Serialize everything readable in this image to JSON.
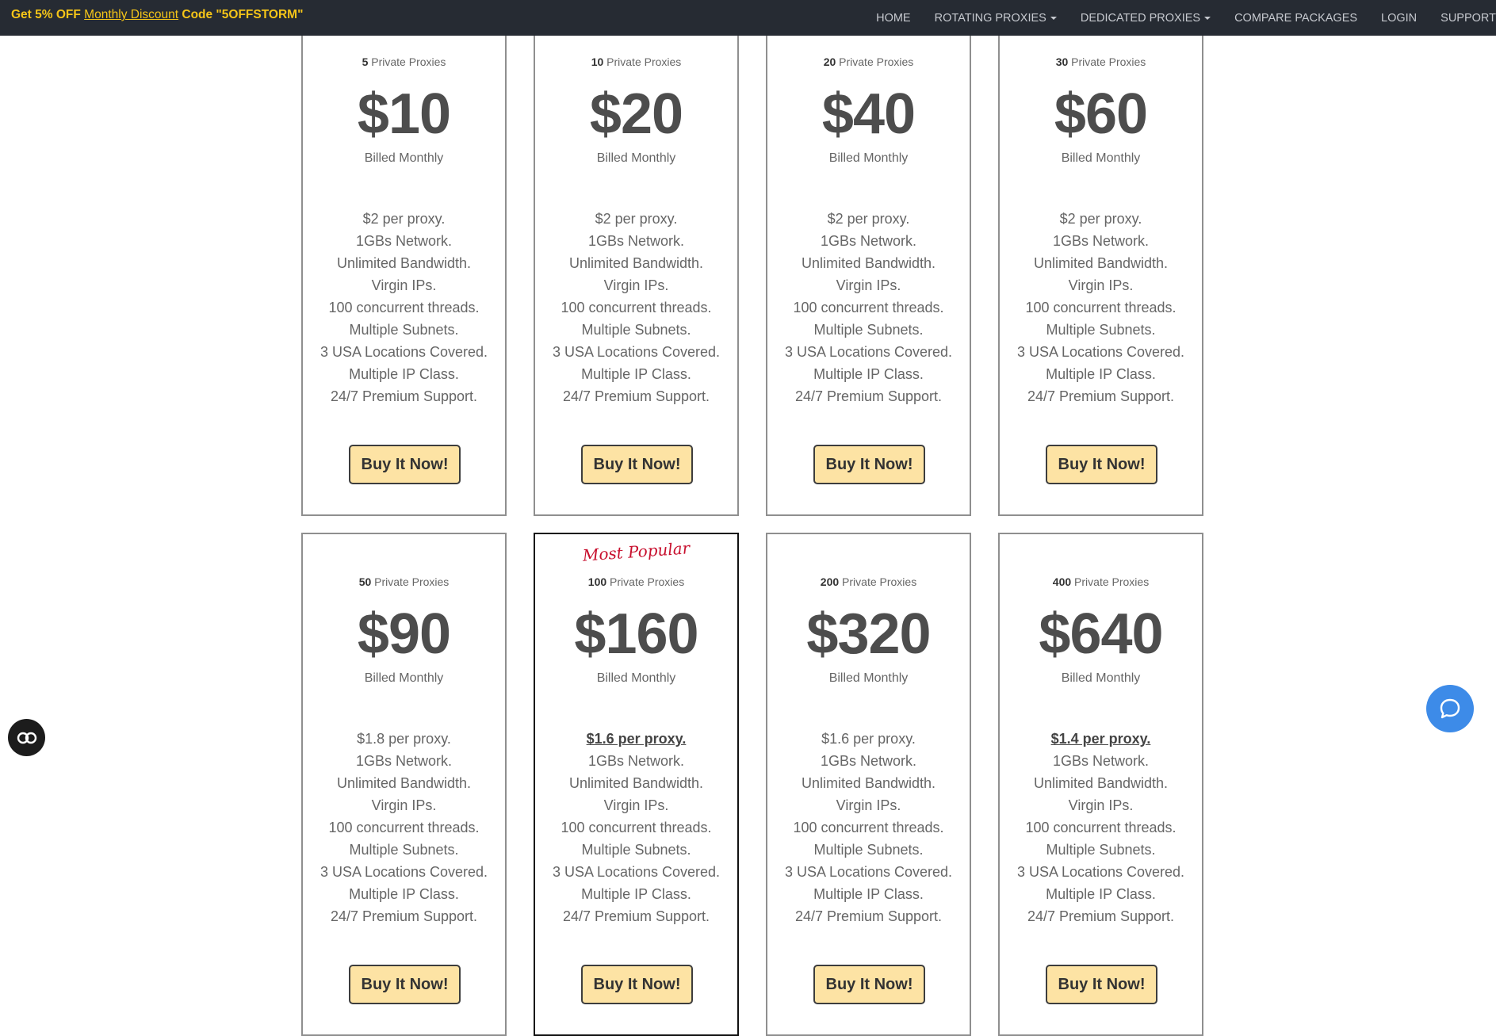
{
  "topbar": {
    "promo_prefix": "Get 5% OFF",
    "promo_link": "Monthly Discount",
    "promo_suffix": "Code \"5OFFSTORM\"",
    "nav": {
      "home": "HOME",
      "rotating": "ROTATING PROXIES",
      "dedicated": "DEDICATED PROXIES",
      "compare": "COMPARE PACKAGES",
      "login": "LOGIN",
      "support": "SUPPORT"
    }
  },
  "plans": [
    {
      "count": "5",
      "unit": "Private Proxies",
      "price": "$10",
      "billed": "Billed Monthly",
      "per_proxy": "$2 per proxy."
    },
    {
      "count": "10",
      "unit": "Private Proxies",
      "price": "$20",
      "billed": "Billed Monthly",
      "per_proxy": "$2 per proxy."
    },
    {
      "count": "20",
      "unit": "Private Proxies",
      "price": "$40",
      "billed": "Billed Monthly",
      "per_proxy": "$2 per proxy."
    },
    {
      "count": "30",
      "unit": "Private Proxies",
      "price": "$60",
      "billed": "Billed Monthly",
      "per_proxy": "$2 per proxy."
    },
    {
      "count": "50",
      "unit": "Private Proxies",
      "price": "$90",
      "billed": "Billed Monthly",
      "per_proxy": "$1.8 per proxy."
    },
    {
      "count": "100",
      "unit": "Private Proxies",
      "price": "$160",
      "billed": "Billed Monthly",
      "per_proxy": "$1.6 per proxy.",
      "tag": "Most Popular"
    },
    {
      "count": "200",
      "unit": "Private Proxies",
      "price": "$320",
      "billed": "Billed Monthly",
      "per_proxy": "$1.6 per proxy."
    },
    {
      "count": "400",
      "unit": "Private Proxies",
      "price": "$640",
      "billed": "Billed Monthly",
      "per_proxy": "$1.4 per proxy."
    }
  ],
  "features": [
    "1GBs Network.",
    "Unlimited Bandwidth.",
    "Virgin IPs.",
    "100 concurrent threads.",
    "Multiple Subnets.",
    "3 USA Locations Covered.",
    "Multiple IP Class.",
    "24/7 Premium Support."
  ],
  "buy_label": "Buy It Now!",
  "widgets": {
    "cookie_icon": "cookie-settings-icon",
    "chat_icon": "chat-bubble-icon"
  },
  "colors": {
    "topbar": "#262b33",
    "promo": "#f5c518",
    "button": "#fde3a4",
    "popular": "#c8102e",
    "chat": "#3d8be8"
  }
}
